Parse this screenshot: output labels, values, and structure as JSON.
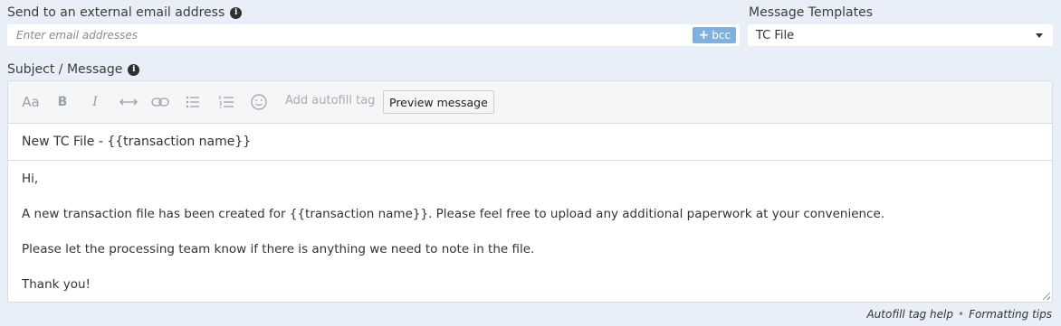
{
  "email": {
    "label": "Send to an external email address",
    "placeholder": "Enter email addresses",
    "value": "",
    "bcc_label": "bcc"
  },
  "templates": {
    "label": "Message Templates",
    "selected": "TC File"
  },
  "message": {
    "label": "Subject / Message",
    "toolbar": {
      "font_size": "Aa",
      "bold": "B",
      "italic": "I",
      "autofill_label": "Add autofill tag",
      "preview_label": "Preview message"
    },
    "subject": "New TC File - {{transaction name}}",
    "body": [
      "Hi,",
      "A new transaction file has been created for {{transaction name}}. Please feel free to upload any additional paperwork at your convenience.",
      "Please let the processing team know if there is anything we need to note in the file.",
      "Thank you!"
    ]
  },
  "footer": {
    "autofill_help": "Autofill tag help",
    "separator": "•",
    "formatting_tips": "Formatting tips"
  },
  "icons": {
    "info": "info-icon",
    "plus": "plus-icon",
    "caret": "chevron-down-icon",
    "toolbar": [
      "font-size-icon",
      "bold-icon",
      "italic-icon",
      "horizontal-rule-icon",
      "link-icon",
      "bulleted-list-icon",
      "numbered-list-icon",
      "emoji-icon"
    ]
  },
  "colors": {
    "background": "#e8eff8",
    "bcc_button": "#7fb0de",
    "toolbar_bg": "#f5f6f8"
  }
}
